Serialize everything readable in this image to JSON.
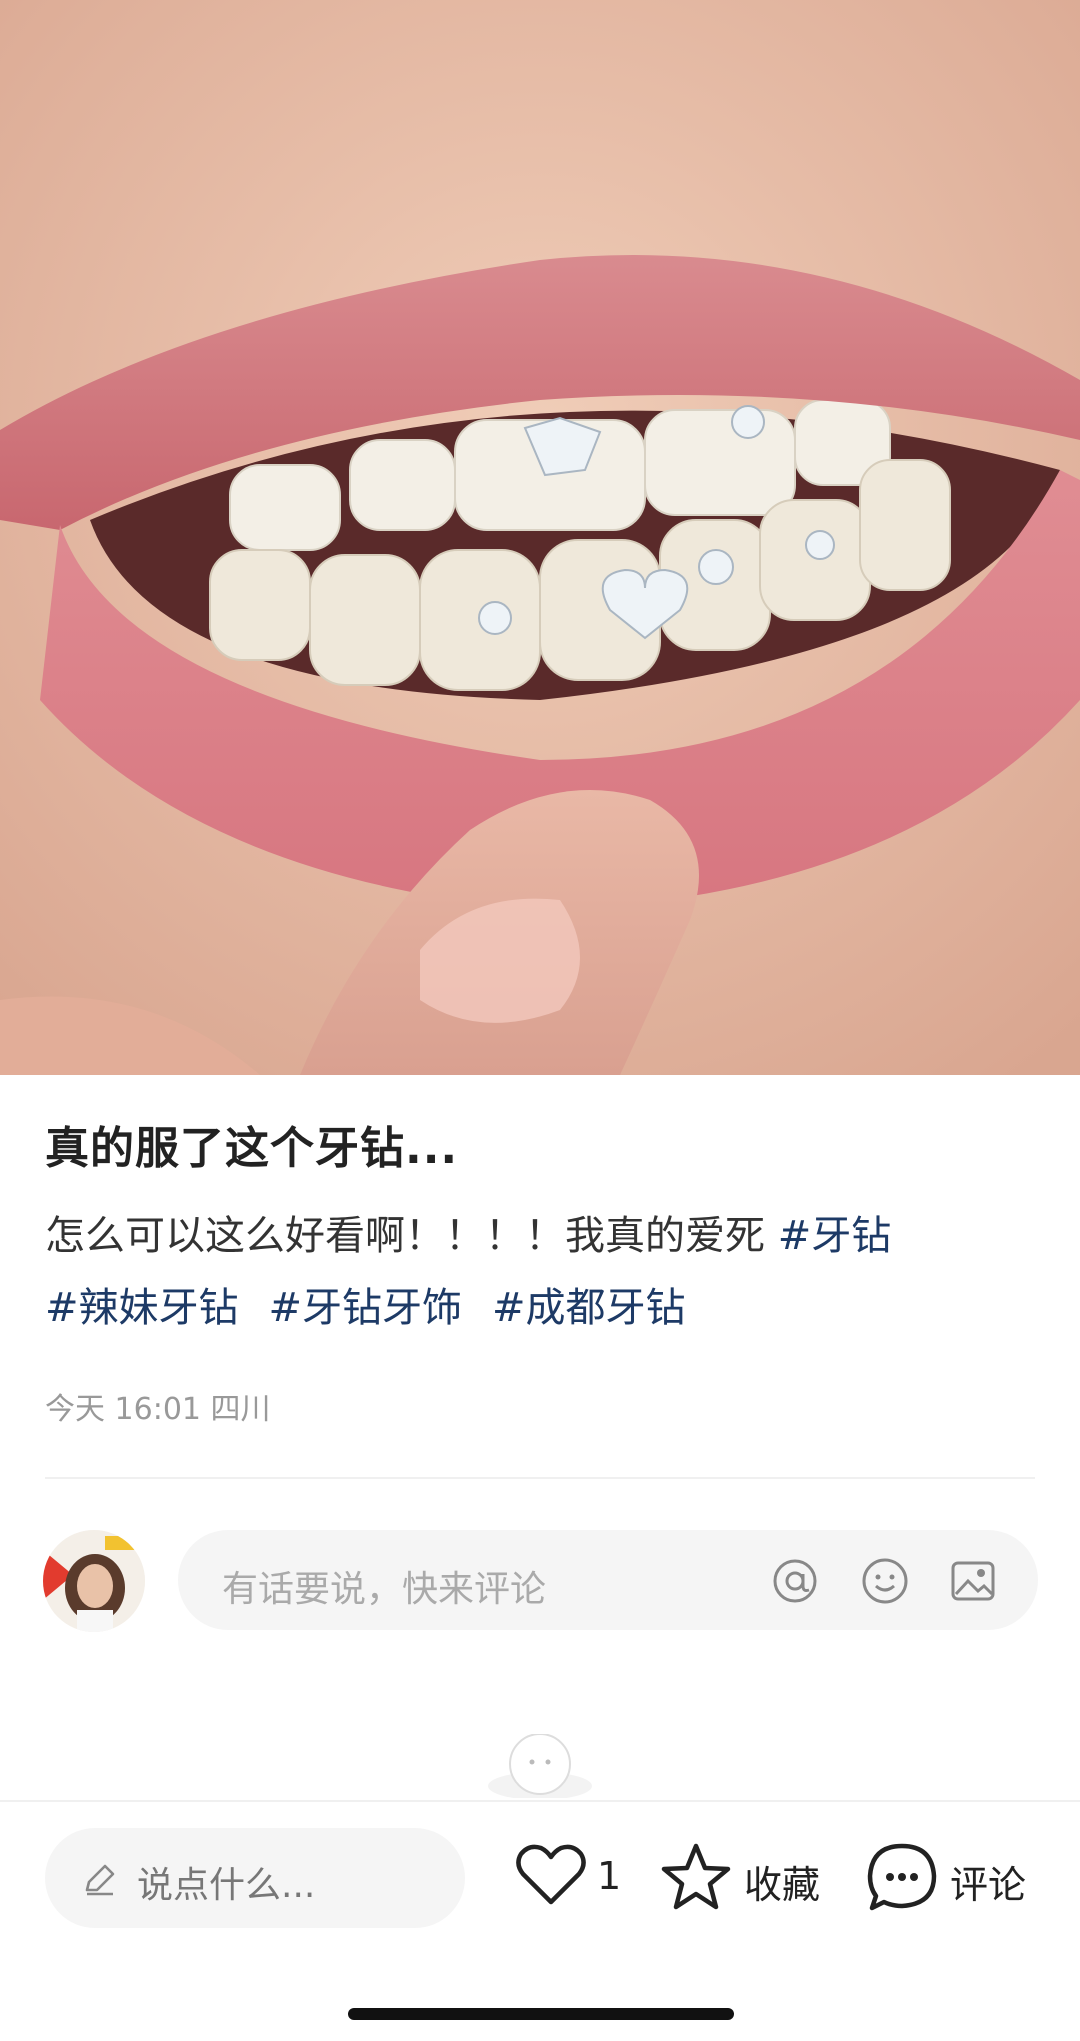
{
  "post": {
    "title": "真的服了这个牙钻...",
    "body": "怎么可以这么好看啊！！！！我真的爱死",
    "tags": [
      "#牙钻",
      "#辣妹牙钻",
      "#牙钻牙饰",
      "#成都牙钻"
    ],
    "meta": "今天 16:01 四川"
  },
  "comment": {
    "placeholder": "有话要说，快来评论",
    "icons": [
      "at-icon",
      "emoji-icon",
      "image-icon"
    ]
  },
  "bottom_bar": {
    "say_placeholder": "说点什么...",
    "like_count": "1",
    "collect_label": "收藏",
    "comment_label": "评论"
  },
  "colors": {
    "tag": "#1d3a66",
    "muted": "#999999",
    "input_bg": "#f5f5f5"
  }
}
